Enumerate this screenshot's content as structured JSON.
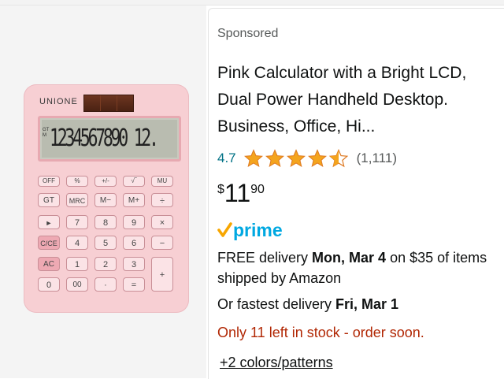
{
  "product": {
    "sponsored_label": "Sponsored",
    "title": "Pink Calculator with a Bright LCD, Dual Power Handheld Desktop. Business, Office, Hi...",
    "rating": "4.7",
    "rating_stars": 4.5,
    "review_count": "(1,111)",
    "price": {
      "symbol": "$",
      "whole": "11",
      "fraction": "90"
    },
    "prime_label": "prime",
    "delivery": {
      "prefix": "FREE delivery ",
      "date": "Mon, Mar 4",
      "suffix": " on $35 of items shipped by Amazon"
    },
    "fastest": {
      "prefix": "Or fastest delivery ",
      "date": "Fri, Mar 1"
    },
    "stock_notice": "Only 11 left in stock - order soon.",
    "colors_link": "+2 colors/patterns"
  },
  "image": {
    "brand": "UNIONE",
    "display_digits": "1234567890 12.",
    "display_gt": "GT M",
    "keys": {
      "r0": [
        "OFF",
        "%",
        "+/-",
        "√‾",
        "MU"
      ],
      "r1": [
        "GT",
        "MRC",
        "M−",
        "M+",
        "÷"
      ],
      "r2": [
        "►",
        "7",
        "8",
        "9",
        "×"
      ],
      "r3": [
        "C/CE",
        "4",
        "5",
        "6",
        "−"
      ],
      "r4": [
        "AC",
        "1",
        "2",
        "3",
        "+"
      ],
      "r5": [
        "0",
        "00",
        "·",
        "="
      ]
    }
  },
  "colors": {
    "link": "#007185",
    "star": "#f4a41d",
    "stock": "#b12704",
    "prime": "#00a8e1",
    "calculator": "#f7cfd3"
  }
}
